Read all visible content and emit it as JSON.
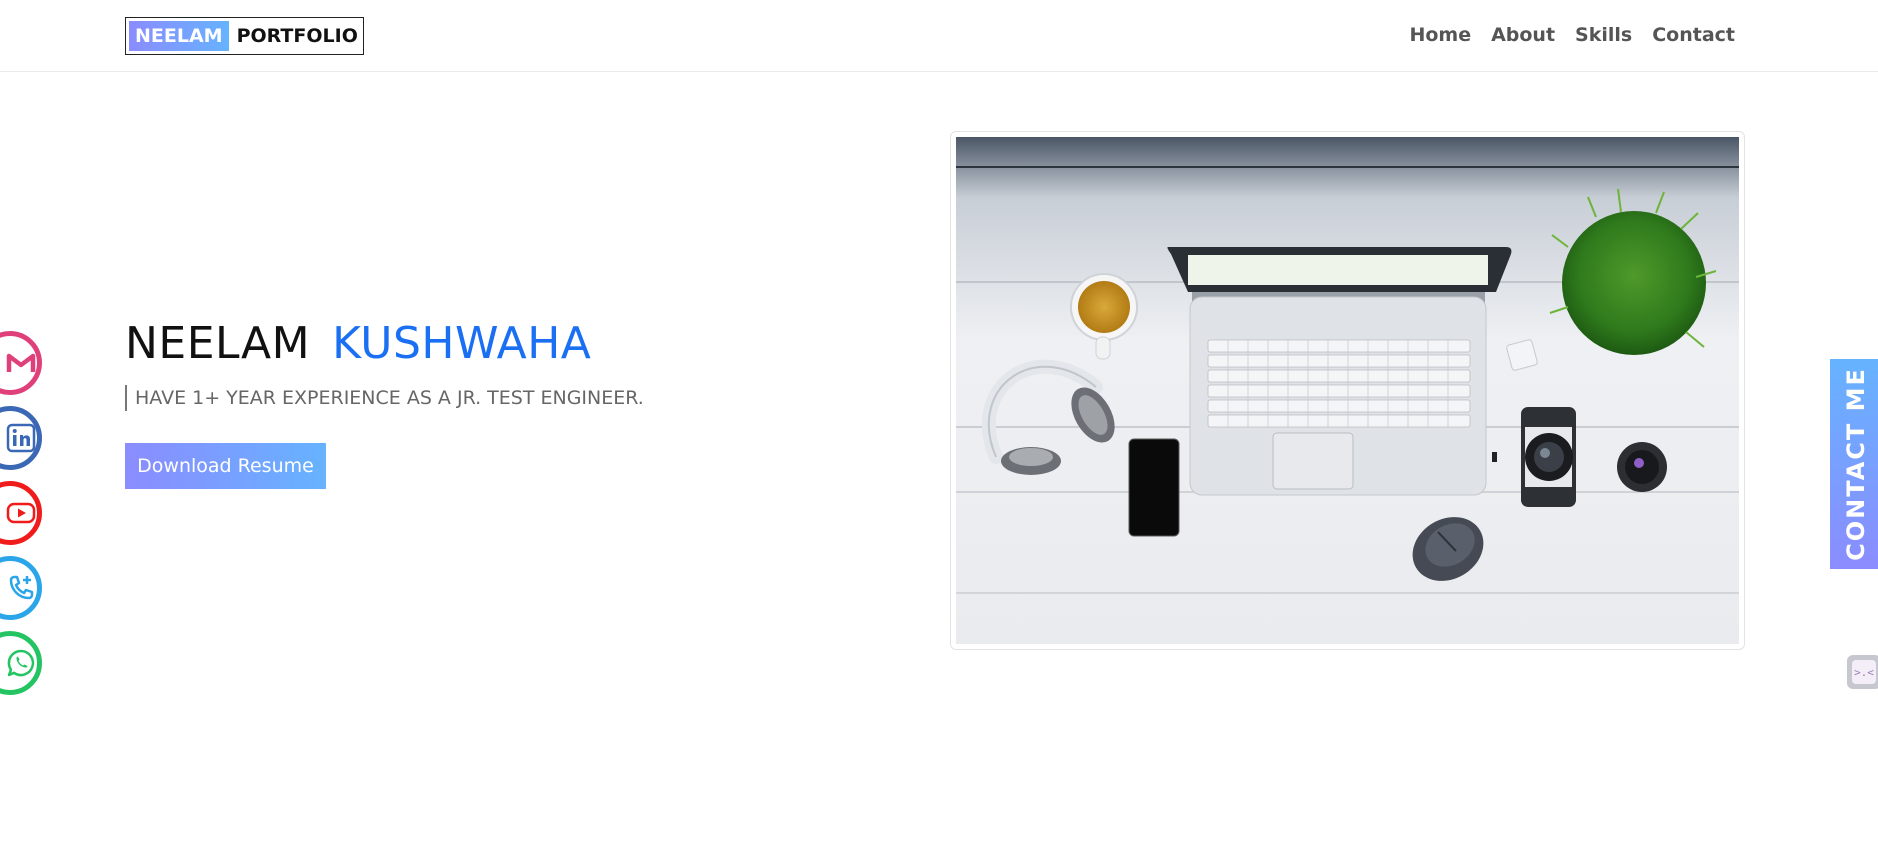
{
  "brand": {
    "first": "NEELAM",
    "second": "PORTFOLIO"
  },
  "nav": {
    "items": [
      {
        "label": "Home"
      },
      {
        "label": "About"
      },
      {
        "label": "Skills"
      },
      {
        "label": "Contact"
      }
    ]
  },
  "social": [
    {
      "icon": "gmail-icon",
      "color": "#e0407a"
    },
    {
      "icon": "linkedin-icon",
      "color": "#3b68b5"
    },
    {
      "icon": "youtube-icon",
      "color": "#f01b1b"
    },
    {
      "icon": "phone-icon",
      "color": "#2aa5ea"
    },
    {
      "icon": "whatsapp-icon",
      "color": "#25c462"
    }
  ],
  "hero": {
    "first_name": "NEELAM",
    "last_name": "KUSHWAHA",
    "tagline": "HAVE 1+ YEAR EXPERIENCE AS A JR. TEST ENGINEER.",
    "button_label": "Download Resume"
  },
  "contact_tab": {
    "label": "CONTACT ME"
  },
  "colors": {
    "accent_blue": "#1a6ff3",
    "gradient_start": "#8b8cff",
    "gradient_end": "#66b3ff"
  }
}
